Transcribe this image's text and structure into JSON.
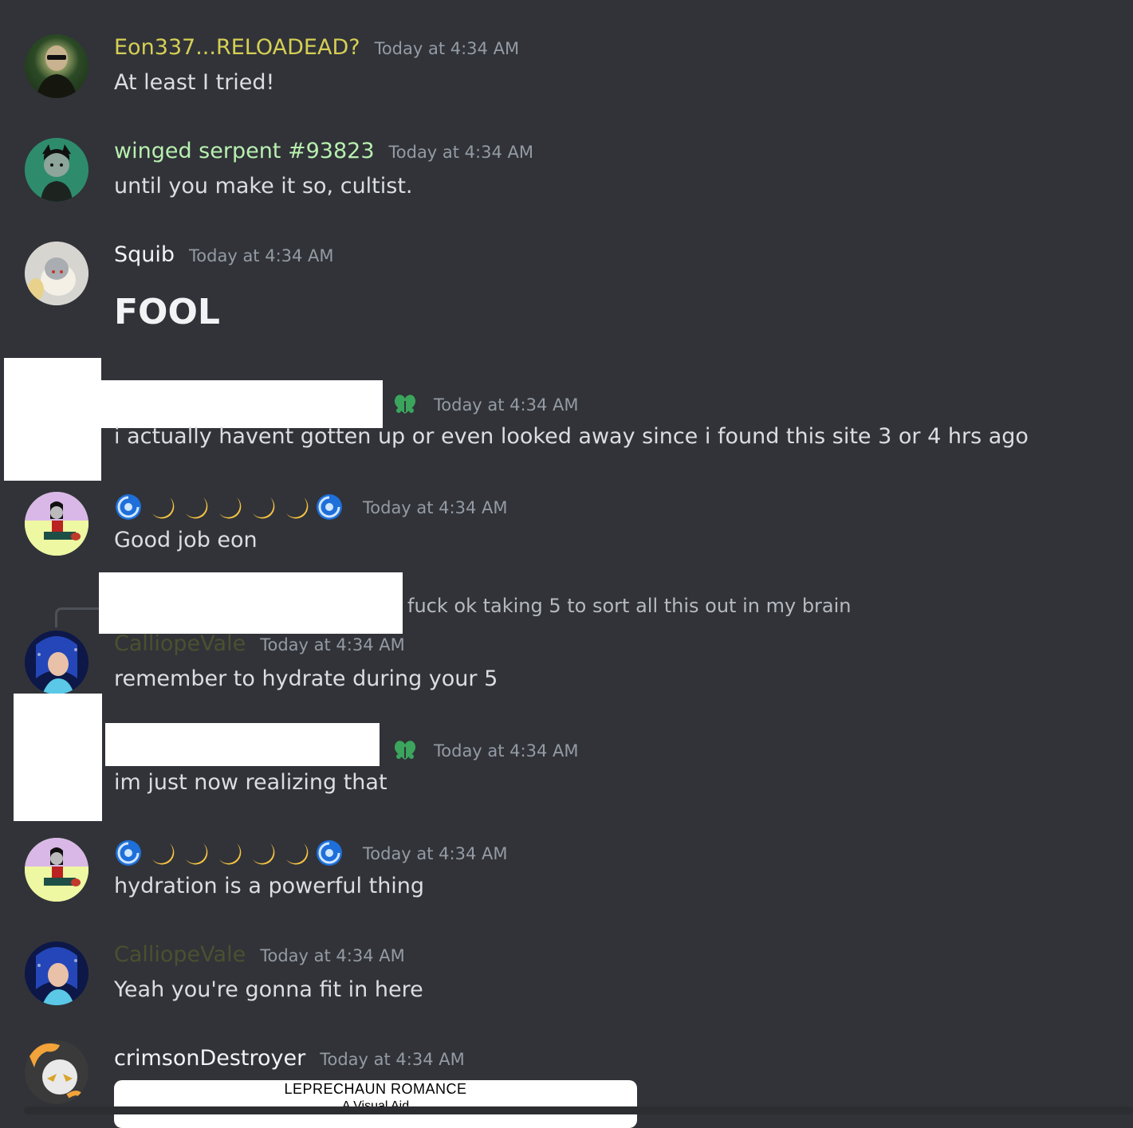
{
  "colors": {
    "background": "#313338",
    "timestamp": "#949ba4",
    "message_text": "#dbdee1",
    "name_eon": "#d6cf55",
    "name_winged": "#b8f0b0",
    "name_squib": "#f2f3f5",
    "name_calliope": "#4b5030",
    "name_crimson": "#f2f3f5",
    "badge_green": "#3ba55d"
  },
  "messages": [
    {
      "username": "Eon337...RELOADEAD?",
      "timestamp": "Today at 4:34 AM",
      "text": "At least I tried!"
    },
    {
      "username": "winged serpent #93823",
      "timestamp": "Today at 4:34 AM",
      "text": "until you make it so, cultist."
    },
    {
      "username": "Squib",
      "timestamp": "Today at 4:34 AM",
      "text": "FOOL"
    },
    {
      "username": "",
      "badge_icon": "clover-heart-icon",
      "timestamp": "Today at 4:34 AM",
      "text": "i actually havent gotten up or even looked away since i found this site 3 or 4 hrs ago"
    },
    {
      "username_icons": [
        "cyclone-icon",
        "crescent-moon-icon",
        "crescent-moon-icon",
        "crescent-moon-icon",
        "crescent-moon-icon",
        "crescent-moon-icon",
        "cyclone-icon"
      ],
      "timestamp": "Today at 4:34 AM",
      "text": "Good job eon"
    },
    {
      "reply_text": "fuck ok taking 5 to sort all this out in my brain",
      "username": "CalliopeVale",
      "timestamp": "Today at 4:34 AM",
      "text": "remember to hydrate during your 5"
    },
    {
      "username": "",
      "badge_icon": "clover-heart-icon",
      "timestamp": "Today at 4:34 AM",
      "text": "im just now realizing that"
    },
    {
      "username_icons": [
        "cyclone-icon",
        "crescent-moon-icon",
        "crescent-moon-icon",
        "crescent-moon-icon",
        "crescent-moon-icon",
        "crescent-moon-icon",
        "cyclone-icon"
      ],
      "timestamp": "Today at 4:34 AM",
      "text": "hydration is a powerful thing"
    },
    {
      "username": "CalliopeVale",
      "timestamp": "Today at 4:34 AM",
      "text": "Yeah you're gonna fit in here"
    },
    {
      "username": "crimsonDestroyer",
      "timestamp": "Today at 4:34 AM",
      "embed_title": "LEPRECHAUN ROMANCE",
      "embed_subtitle": "A Visual Aid"
    }
  ]
}
